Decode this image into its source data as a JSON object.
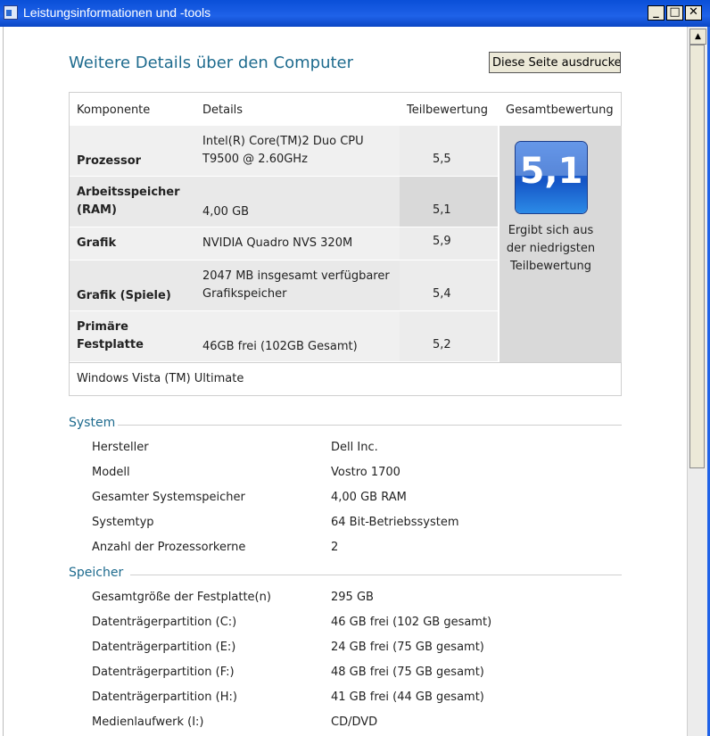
{
  "window": {
    "title": "Leistungsinformationen und -tools",
    "controls": [
      "_",
      "□",
      "✕"
    ]
  },
  "page": {
    "title": "Weitere Details über den Computer",
    "print_button": "Diese Seite ausdrucke"
  },
  "score_table": {
    "headers": {
      "component": "Komponente",
      "details": "Details",
      "subscore": "Teilbewertung",
      "basescore": "Gesamtbewertung"
    },
    "rows": [
      {
        "component": "Prozessor",
        "details": "Intel(R) Core(TM)2 Duo CPU T9500 @ 2.60GHz",
        "score": "5,5"
      },
      {
        "component": "Arbeitsspeicher (RAM)",
        "details": "4,00 GB",
        "score": "5,1"
      },
      {
        "component": "Grafik",
        "details": "NVIDIA Quadro NVS 320M",
        "score": "5,9"
      },
      {
        "component": "Grafik (Spiele)",
        "details": "2047 MB insgesamt verfügbarer Grafikspeicher",
        "score": "5,4"
      },
      {
        "component": "Primäre Festplatte",
        "details": "46GB frei (102GB Gesamt)",
        "score": "5,2"
      }
    ],
    "base_score": "5,1",
    "base_score_note": "Ergibt sich aus der niedrigsten Teilbewertung",
    "os": "Windows Vista (TM) Ultimate"
  },
  "system": {
    "title": "System",
    "items": [
      {
        "key": "Hersteller",
        "value": "Dell Inc."
      },
      {
        "key": "Modell",
        "value": "Vostro 1700"
      },
      {
        "key": "Gesamter Systemspeicher",
        "value": "4,00 GB RAM"
      },
      {
        "key": "Systemtyp",
        "value": "64 Bit-Betriebssystem"
      },
      {
        "key": "Anzahl der Prozessorkerne",
        "value": "2"
      }
    ]
  },
  "storage": {
    "title": "Speicher",
    "items": [
      {
        "key": "Gesamtgröße der Festplatte(n)",
        "value": "295 GB"
      },
      {
        "key": "Datenträgerpartition (C:)",
        "value": "46 GB frei (102 GB gesamt)"
      },
      {
        "key": "Datenträgerpartition (E:)",
        "value": "24 GB frei (75 GB gesamt)"
      },
      {
        "key": "Datenträgerpartition (F:)",
        "value": "48 GB frei (75 GB gesamt)"
      },
      {
        "key": "Datenträgerpartition (H:)",
        "value": "41 GB frei (44 GB gesamt)"
      },
      {
        "key": "Medienlaufwerk (I:)",
        "value": "CD/DVD"
      }
    ]
  }
}
